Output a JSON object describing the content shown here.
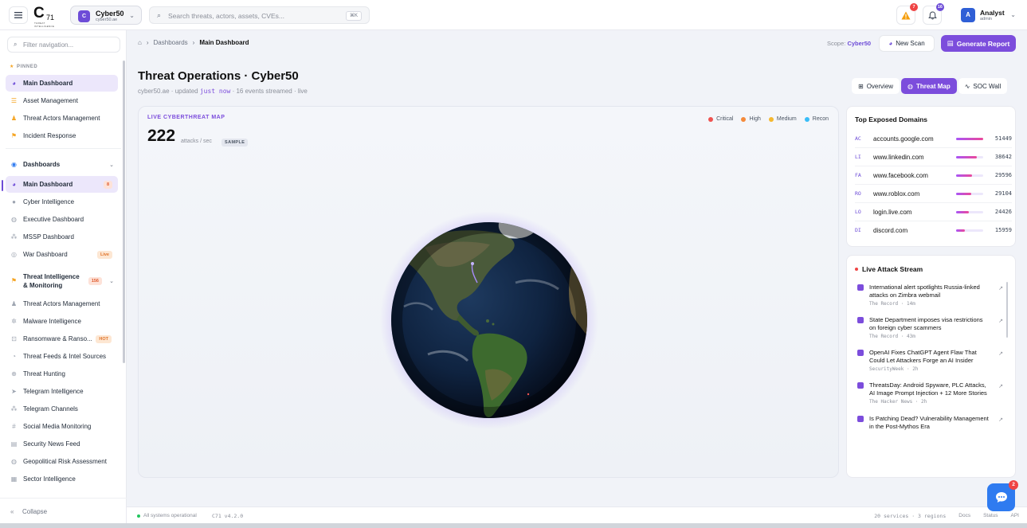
{
  "brand": {
    "logo_main": "C",
    "logo_num": "71",
    "logo_tag": "THREAT INTELLIGENCE"
  },
  "workspace": {
    "badge": "C",
    "name": "Cyber50",
    "domain": "cyber50.ae"
  },
  "search": {
    "placeholder": "Search threats, actors, assets, CVEs...",
    "shortcut": "⌘K"
  },
  "topbar": {
    "alerts_count": "7",
    "notifications_count": "16"
  },
  "user": {
    "initial": "A",
    "name": "Analyst",
    "role": "admin"
  },
  "sidebar": {
    "filter_placeholder": "Filter navigation...",
    "pinned_label": "PINNED",
    "pinned": [
      "Main Dashboard",
      "Asset Management",
      "Threat Actors Management",
      "Incident Response"
    ],
    "dashboards_label": "Dashboards",
    "dashboards": [
      {
        "label": "Main Dashboard",
        "badge": "8"
      },
      {
        "label": "Cyber Intelligence"
      },
      {
        "label": "Executive Dashboard"
      },
      {
        "label": "MSSP Dashboard"
      },
      {
        "label": "War Dashboard",
        "badge": "Live"
      }
    ],
    "ti_label_1": "Threat Intelligence",
    "ti_label_2": "& Monitoring",
    "ti_badge": "156",
    "ti_items": [
      {
        "label": "Threat Actors Management"
      },
      {
        "label": "Malware Intelligence"
      },
      {
        "label": "Ransomware & Ranso...",
        "badge": "HOT"
      },
      {
        "label": "Threat Feeds & Intel Sources"
      },
      {
        "label": "Threat Hunting"
      },
      {
        "label": "Telegram Intelligence"
      },
      {
        "label": "Telegram Channels"
      },
      {
        "label": "Social Media Monitoring"
      },
      {
        "label": "Security News Feed"
      },
      {
        "label": "Geopolitical Risk Assessment"
      },
      {
        "label": "Sector Intelligence"
      }
    ],
    "collapse_label": "Collapse"
  },
  "breadcrumb": {
    "parent": "Dashboards",
    "current": "Main Dashboard"
  },
  "actions": {
    "scope_label": "Scope:",
    "scope_value": "Cyber50",
    "new_scan": "New Scan",
    "generate_report": "Generate Report"
  },
  "page": {
    "title": "Threat Operations · Cyber50",
    "sub_domain": "cyber50.ae · updated ",
    "sub_time": "just now",
    "sub_rest": " · 16 events streamed · live"
  },
  "views": [
    "Overview",
    "Threat Map",
    "SOC Wall"
  ],
  "map": {
    "tag": "LIVE CYBERTHREAT MAP",
    "rate": "222",
    "unit": "attacks / sec",
    "sample": "SAMPLE",
    "legend": [
      {
        "label": "Critical",
        "color": "#ef5350"
      },
      {
        "label": "High",
        "color": "#f58a3a"
      },
      {
        "label": "Medium",
        "color": "#f5b82e"
      },
      {
        "label": "Recon",
        "color": "#38bdf8"
      }
    ]
  },
  "domains": {
    "title": "Top Exposed Domains",
    "rows": [
      {
        "code": "AC",
        "domain": "accounts.google.com",
        "count": "51449",
        "share": 1.0
      },
      {
        "code": "LI",
        "domain": "www.linkedin.com",
        "count": "38642",
        "share": 0.75
      },
      {
        "code": "FA",
        "domain": "www.facebook.com",
        "count": "29596",
        "share": 0.58
      },
      {
        "code": "RO",
        "domain": "www.roblox.com",
        "count": "29104",
        "share": 0.57
      },
      {
        "code": "LO",
        "domain": "login.live.com",
        "count": "24426",
        "share": 0.47
      },
      {
        "code": "DI",
        "domain": "discord.com",
        "count": "15959",
        "share": 0.31
      }
    ]
  },
  "stream": {
    "title": "Live Attack Stream",
    "items": [
      {
        "title": "International alert spotlights Russia-linked attacks on Zimbra webmail",
        "source": "The Record",
        "age": "14m"
      },
      {
        "title": "State Department imposes visa restrictions on foreign cyber scammers",
        "source": "The Record",
        "age": "43m"
      },
      {
        "title": "OpenAI Fixes ChatGPT Agent Flaw That Could Let Attackers Forge an AI Insider",
        "source": "SecurityWeek",
        "age": "2h"
      },
      {
        "title": "ThreatsDay: Android Spyware, PLC Attacks, AI Image Prompt Injection + 12 More Stories",
        "source": "The Hacker News",
        "age": "2h"
      },
      {
        "title": "Is Patching Dead? Vulnerability Management in the Post-Mythos Era",
        "source": "",
        "age": ""
      }
    ]
  },
  "footer": {
    "status": "All systems operational",
    "version": "C71 v4.2.0",
    "services": "20 services · 3 regions",
    "docs": "Docs",
    "status_link": "Status",
    "api": "API"
  },
  "chat": {
    "count": "2"
  },
  "colors": {
    "accent": "#7c4ddc",
    "live": "#ef4444",
    "ok": "#22c55e"
  }
}
